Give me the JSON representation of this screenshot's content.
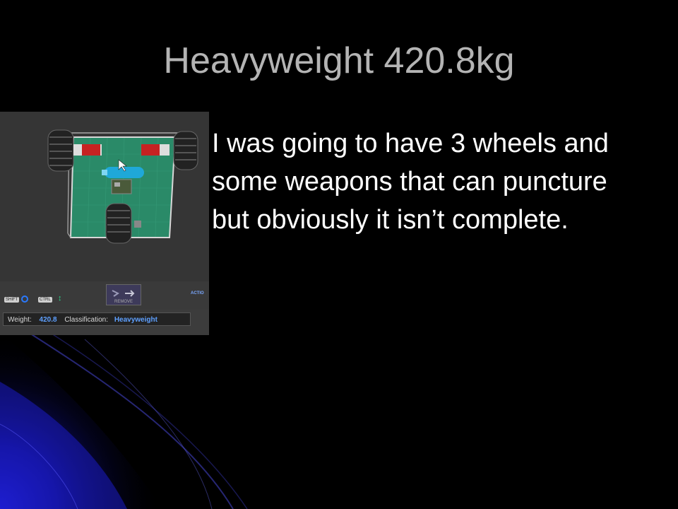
{
  "slide": {
    "title": "Heavyweight 420.8kg",
    "body": "I was going to have 3 wheels and some weapons that can puncture but obviously it isn’t complete."
  },
  "screenshot": {
    "status_bar": {
      "weight_label": "Weight:",
      "weight_value": "420.8",
      "classification_label": "Classification:",
      "classification_value": "Heavyweight"
    },
    "controls": {
      "shift_key": "SHIFT",
      "ctrl_key": "CTRL",
      "remove_label": "REMOVE",
      "actions_label": "ACTIO"
    }
  },
  "colors": {
    "background": "#000000",
    "title": "#b4b4b4",
    "body_text": "#ffffff",
    "accent_blue": "#1a1ab8",
    "floor_green": "#2a8a68"
  }
}
